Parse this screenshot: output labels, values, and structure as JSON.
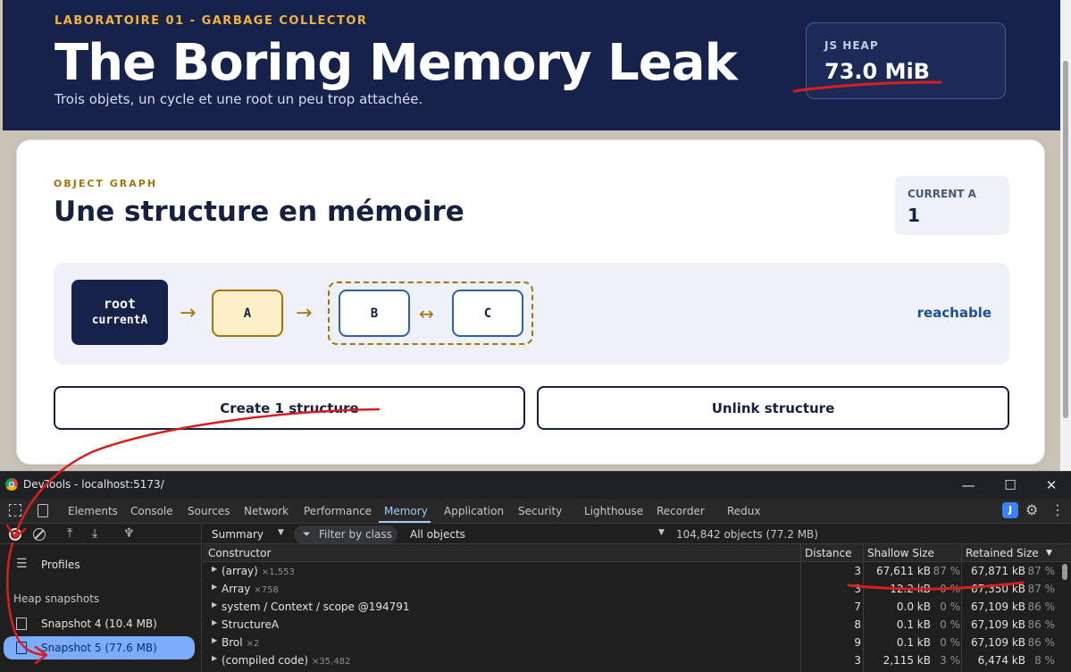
{
  "hero": {
    "kicker": "LABORATOIRE 01 - GARBAGE COLLECTOR",
    "title": "The Boring Memory Leak",
    "subtitle": "Trois objets, un cycle et une root un peu trop attachée.",
    "heap_label": "JS HEAP",
    "heap_value": "73.0 MiB"
  },
  "card": {
    "kicker": "OBJECT GRAPH",
    "title": "Une structure en mémoire",
    "current_label": "CURRENT A",
    "current_value": "1",
    "graph": {
      "root_label": "root",
      "root_sub": "currentA",
      "arrow": "→",
      "node_a": "A",
      "node_b": "B",
      "node_c": "C",
      "bi_arrow": "↔",
      "status": "reachable"
    },
    "create_button": "Create 1 structure",
    "unlink_button": "Unlink structure"
  },
  "devtools": {
    "window_title": "DevTools - localhost:5173/",
    "window_controls": {
      "minimize": "—",
      "maximize": "☐",
      "close": "✕"
    },
    "tabs": [
      "Elements",
      "Console",
      "Sources",
      "Network",
      "Performance",
      "Memory",
      "Application",
      "Security",
      "Lighthouse",
      "Recorder",
      "Redux"
    ],
    "active_tab": "Memory",
    "ext_badge": "J",
    "sidebar": {
      "profiles": "Profiles",
      "section": "Heap snapshots",
      "snapshots": [
        {
          "label": "Snapshot 4 (10.4 MB)",
          "selected": false
        },
        {
          "label": "Snapshot 5 (77.6 MB)",
          "selected": true
        }
      ]
    },
    "toolbar": {
      "view": "Summary",
      "filter_placeholder": "Filter by class",
      "objects_filter": "All objects",
      "object_count": "104,842 objects (77.2 MB)"
    },
    "columns": {
      "constructor": "Constructor",
      "distance": "Distance",
      "shallow": "Shallow Size",
      "retained": "Retained Size"
    },
    "rows": [
      {
        "name": "(array)",
        "count": "×1,553",
        "distance": "3",
        "shallow": "67,611 kB",
        "shallow_pct": "87 %",
        "retained": "67,871 kB",
        "retained_pct": "87 %"
      },
      {
        "name": "Array",
        "count": "×758",
        "distance": "3",
        "shallow": "12.2 kB",
        "shallow_pct": "0 %",
        "retained": "67,350 kB",
        "retained_pct": "87 %"
      },
      {
        "name": "system / Context / scope @194791",
        "count": "",
        "distance": "7",
        "shallow": "0.0 kB",
        "shallow_pct": "0 %",
        "retained": "67,109 kB",
        "retained_pct": "86 %"
      },
      {
        "name": "StructureA",
        "count": "",
        "distance": "8",
        "shallow": "0.1 kB",
        "shallow_pct": "0 %",
        "retained": "67,109 kB",
        "retained_pct": "86 %"
      },
      {
        "name": "Brol",
        "count": "×2",
        "distance": "9",
        "shallow": "0.1 kB",
        "shallow_pct": "0 %",
        "retained": "67,109 kB",
        "retained_pct": "86 %"
      },
      {
        "name": "(compiled code)",
        "count": "×35,482",
        "distance": "3",
        "shallow": "2,115 kB",
        "shallow_pct": "3 %",
        "retained": "6,474 kB",
        "retained_pct": "8 %"
      }
    ]
  },
  "colors": {
    "hero_bg": "#17224a",
    "accent_gold": "#a8720f",
    "accent_blue": "#3162a8",
    "devtools_active": "#a8c7fa",
    "annotation_red": "#d62020"
  }
}
